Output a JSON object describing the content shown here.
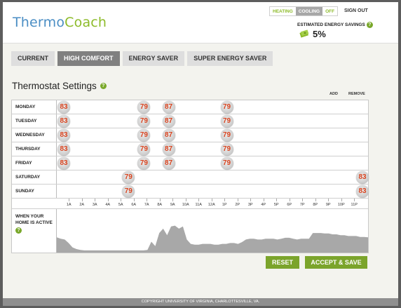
{
  "header": {
    "logo_part1": "Thermo",
    "logo_part2": "Coach",
    "mode_toggle": [
      "HEATING",
      "COOLING",
      "OFF"
    ],
    "mode_active": "COOLING",
    "sign_out": "SIGN OUT",
    "savings_label": "ESTIMATED ENERGY SAVINGS",
    "savings_value": "5%",
    "help_glyph": "?"
  },
  "tabs": [
    {
      "label": "CURRENT",
      "active": false
    },
    {
      "label": "HIGH COMFORT",
      "active": true
    },
    {
      "label": "ENERGY SAVER",
      "active": false
    },
    {
      "label": "SUPER ENERGY SAVER",
      "active": false
    }
  ],
  "settings": {
    "title": "Thermostat Settings",
    "add_label": "ADD",
    "remove_label": "REMOVE"
  },
  "schedule": [
    {
      "day": "MONDAY",
      "setpoints": [
        {
          "hour": 0,
          "temp": "83"
        },
        {
          "hour": 6.2,
          "temp": "79"
        },
        {
          "hour": 8.1,
          "temp": "87"
        },
        {
          "hour": 12.6,
          "temp": "79"
        }
      ]
    },
    {
      "day": "TUESDAY",
      "setpoints": [
        {
          "hour": 0,
          "temp": "83"
        },
        {
          "hour": 6.2,
          "temp": "79"
        },
        {
          "hour": 8.1,
          "temp": "87"
        },
        {
          "hour": 12.6,
          "temp": "79"
        }
      ]
    },
    {
      "day": "WEDNESDAY",
      "setpoints": [
        {
          "hour": 0,
          "temp": "83"
        },
        {
          "hour": 6.2,
          "temp": "79"
        },
        {
          "hour": 8.1,
          "temp": "87"
        },
        {
          "hour": 12.6,
          "temp": "79"
        }
      ]
    },
    {
      "day": "THURSDAY",
      "setpoints": [
        {
          "hour": 0,
          "temp": "83"
        },
        {
          "hour": 6.2,
          "temp": "79"
        },
        {
          "hour": 8.1,
          "temp": "87"
        },
        {
          "hour": 12.6,
          "temp": "79"
        }
      ]
    },
    {
      "day": "FRIDAY",
      "setpoints": [
        {
          "hour": 0,
          "temp": "83"
        },
        {
          "hour": 6.2,
          "temp": "79"
        },
        {
          "hour": 8.1,
          "temp": "87"
        },
        {
          "hour": 12.6,
          "temp": "79"
        }
      ]
    },
    {
      "day": "SATURDAY",
      "setpoints": [
        {
          "hour": 5,
          "temp": "79"
        },
        {
          "hour": 23.9,
          "temp": "83"
        }
      ]
    },
    {
      "day": "SUNDAY",
      "setpoints": [
        {
          "hour": 5,
          "temp": "79"
        },
        {
          "hour": 23.9,
          "temp": "83"
        }
      ]
    }
  ],
  "hours": [
    "1A",
    "2A",
    "3A",
    "4A",
    "5A",
    "6A",
    "7A",
    "8A",
    "9A",
    "10A",
    "11A",
    "12A",
    "1P",
    "2P",
    "3P",
    "4P",
    "5P",
    "6P",
    "7P",
    "8P",
    "9P",
    "10P",
    "11P"
  ],
  "activity": {
    "label_line1": "WHEN YOUR",
    "label_line2": "HOME IS ACTIVE",
    "fill_color": "#a8a8a8",
    "levels": [
      0.35,
      0.32,
      0.3,
      0.22,
      0.12,
      0.08,
      0.06,
      0.05,
      0.05,
      0.05,
      0.05,
      0.05,
      0.05,
      0.05,
      0.05,
      0.05,
      0.05,
      0.05,
      0.05,
      0.05,
      0.05,
      0.05,
      0.05,
      0.06,
      0.25,
      0.15,
      0.45,
      0.55,
      0.4,
      0.6,
      0.62,
      0.55,
      0.6,
      0.3,
      0.2,
      0.18,
      0.18,
      0.2,
      0.2,
      0.2,
      0.18,
      0.18,
      0.2,
      0.2,
      0.22,
      0.22,
      0.2,
      0.24,
      0.3,
      0.32,
      0.32,
      0.3,
      0.3,
      0.32,
      0.32,
      0.32,
      0.3,
      0.32,
      0.34,
      0.34,
      0.32,
      0.3,
      0.32,
      0.32,
      0.32,
      0.45,
      0.45,
      0.45,
      0.44,
      0.44,
      0.42,
      0.42,
      0.4,
      0.4,
      0.38,
      0.38,
      0.38,
      0.36,
      0.36,
      0.35
    ]
  },
  "buttons": {
    "reset": "RESET",
    "accept": "ACCEPT & SAVE",
    "color": "#7ba42b"
  },
  "footer": "COPYRIGHT UNIVERSITY OF VIRGINIA, CHARLOTTESVILLE, VA.",
  "colors": {
    "logo_blue": "#4b8ec4",
    "logo_green": "#8dbb2a",
    "temp_text": "#d9431e",
    "active_tab": "#808080"
  }
}
